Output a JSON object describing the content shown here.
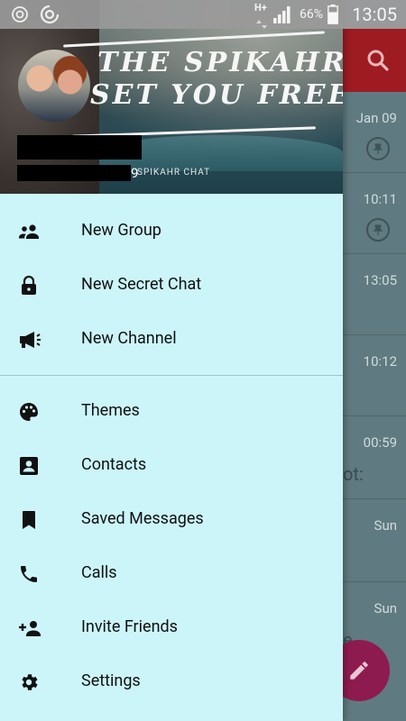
{
  "status_bar": {
    "network_type": "H+",
    "battery_percent": "66%",
    "time": "13:05"
  },
  "drawer": {
    "header": {
      "banner_line_1": "THE SPIKAHR",
      "banner_line_2": "SET YOU FREE",
      "phone_tail": "9",
      "watermark": "SPIKAHR CHAT"
    },
    "menu_section_1": [
      {
        "label": "New Group",
        "icon": "new-group-icon"
      },
      {
        "label": "New Secret Chat",
        "icon": "lock-icon"
      },
      {
        "label": "New Channel",
        "icon": "megaphone-icon"
      }
    ],
    "menu_section_2": [
      {
        "label": "Themes",
        "icon": "palette-icon"
      },
      {
        "label": "Contacts",
        "icon": "contacts-icon"
      },
      {
        "label": "Saved Messages",
        "icon": "bookmark-icon"
      },
      {
        "label": "Calls",
        "icon": "phone-icon"
      },
      {
        "label": "Invite Friends",
        "icon": "add-person-icon"
      },
      {
        "label": "Settings",
        "icon": "gear-icon"
      }
    ]
  },
  "background_chat_list": {
    "rows": [
      {
        "time": "Jan 09",
        "snippet": ""
      },
      {
        "time": "10:11",
        "snippet": ""
      },
      {
        "time": "13:05",
        "snippet": ""
      },
      {
        "time": "10:12",
        "snippet": ""
      },
      {
        "time": "00:59",
        "snippet": "ot:"
      },
      {
        "time": "Sun",
        "snippet": ""
      },
      {
        "time": "Sun",
        "snippet": "e..."
      }
    ]
  },
  "colors": {
    "toolbar": "#9e1b22",
    "drawer_bg": "#ccf5fa",
    "fab": "#8e1b4f"
  }
}
